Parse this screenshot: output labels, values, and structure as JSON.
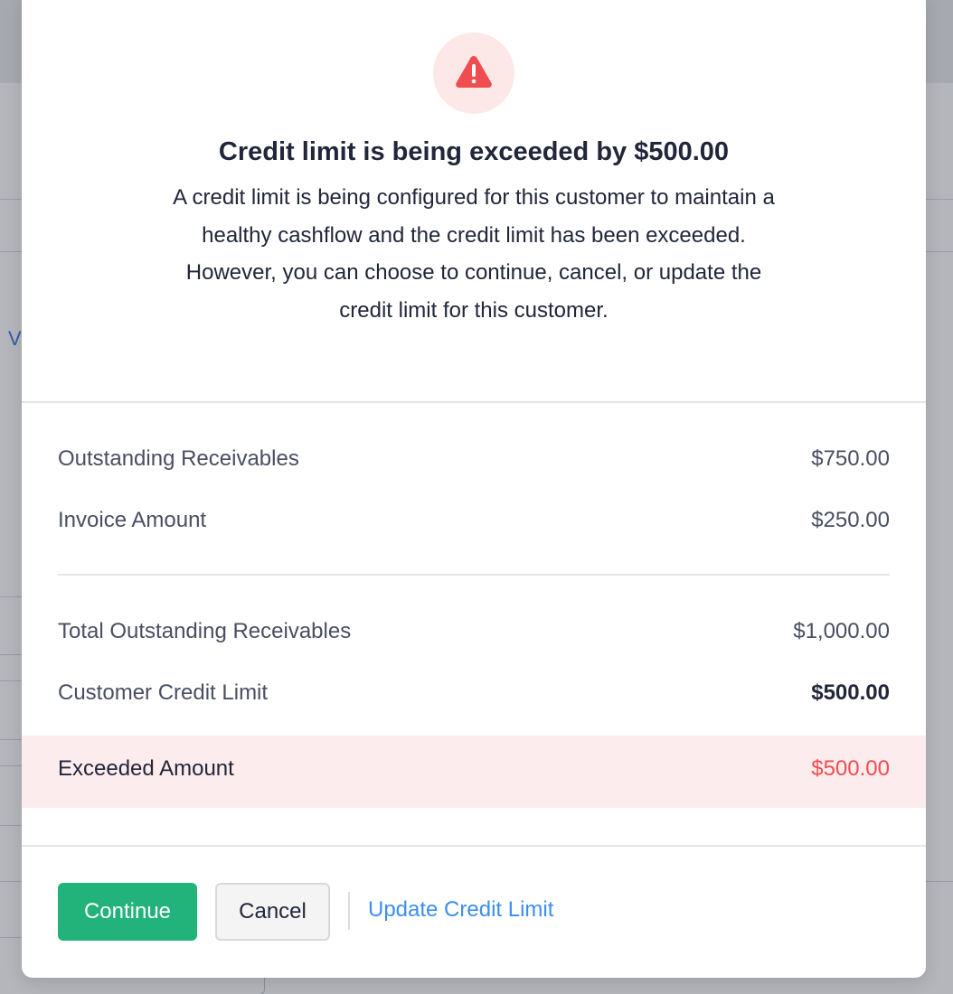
{
  "background": {
    "partial_link_text": "V"
  },
  "modal": {
    "icon": "warning-triangle-icon",
    "title": "Credit limit is being exceeded by $500.00",
    "message": "A credit limit is being configured for this customer to maintain a healthy cashflow and the credit limit has been exceeded. However, you can choose to continue, cancel, or update the credit limit for this customer.",
    "summary": {
      "outstanding_receivables": {
        "label": "Outstanding Receivables",
        "value": "$750.00"
      },
      "invoice_amount": {
        "label": "Invoice Amount",
        "value": "$250.00"
      },
      "total_outstanding": {
        "label": "Total Outstanding Receivables",
        "value": "$1,000.00"
      },
      "credit_limit": {
        "label": "Customer Credit Limit",
        "value": "$500.00"
      },
      "exceeded": {
        "label": "Exceeded Amount",
        "value": "$500.00"
      }
    },
    "actions": {
      "continue_label": "Continue",
      "cancel_label": "Cancel",
      "update_label": "Update Credit Limit"
    }
  },
  "colors": {
    "danger": "#ef4d50",
    "danger_bg": "#fdeced",
    "primary_green": "#21b37a",
    "link_blue": "#3a8ff0"
  }
}
